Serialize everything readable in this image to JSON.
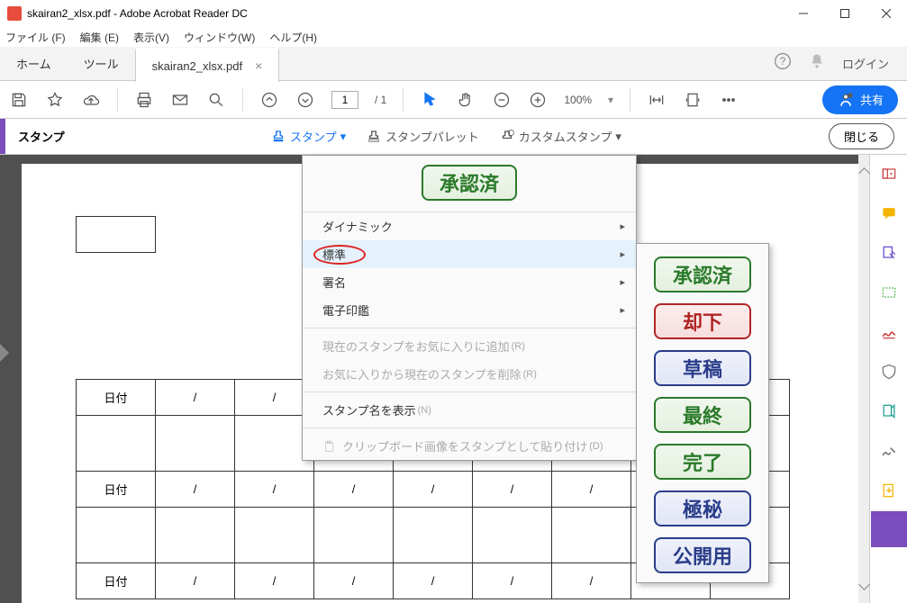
{
  "window": {
    "title": "skairan2_xlsx.pdf - Adobe Acrobat Reader DC"
  },
  "menubar": {
    "file": "ファイル (F)",
    "edit": "編集 (E)",
    "view": "表示(V)",
    "window": "ウィンドウ(W)",
    "help": "ヘルプ(H)"
  },
  "tabs": {
    "home": "ホーム",
    "tools": "ツール",
    "doc": "skairan2_xlsx.pdf",
    "signin": "ログイン"
  },
  "toolbar": {
    "page_current": "1",
    "page_total": "/ 1",
    "zoom": "100%",
    "share": "共有"
  },
  "stampbar": {
    "label": "スタンプ",
    "stamp": "スタンプ",
    "palette": "スタンプパレット",
    "custom": "カスタムスタンプ",
    "close": "閉じる"
  },
  "doc": {
    "date_label": "日付",
    "slash": "/"
  },
  "menu": {
    "favorite_stamp": "承認済",
    "dynamic": "ダイナミック",
    "standard": "標準",
    "signature": "署名",
    "eseal": "電子印鑑",
    "add_fav": "現在のスタンプをお気に入りに追加",
    "add_fav_key": "(R)",
    "del_fav": "お気に入りから現在のスタンプを削除",
    "del_fav_key": "(R)",
    "show_name": "スタンプ名を表示",
    "show_name_key": "(N)",
    "paste_clip": "クリップボード画像をスタンプとして貼り付け",
    "paste_clip_key": "(D)"
  },
  "sub_stamps": {
    "approved": "承認済",
    "rejected": "却下",
    "draft": "草稿",
    "final": "最終",
    "done": "完了",
    "secret": "極秘",
    "public": "公開用"
  }
}
